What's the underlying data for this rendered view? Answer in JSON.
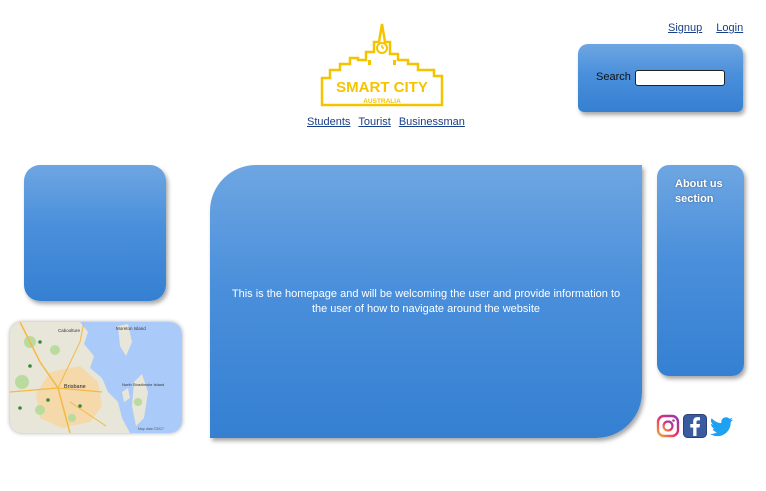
{
  "header": {
    "signup_label": "Signup",
    "login_label": "Login"
  },
  "logo": {
    "title": "SMART CITY",
    "subtitle": "AUSTRALIA",
    "color": "#f5c400"
  },
  "nav": {
    "items": [
      {
        "label": "Students"
      },
      {
        "label": "Tourist"
      },
      {
        "label": "Businessman"
      }
    ]
  },
  "search": {
    "label": "Search",
    "value": ""
  },
  "main": {
    "text": "This is the homepage and will be welcoming the user and provide information to the user of how to navigate around the website"
  },
  "about": {
    "text": "About us section"
  },
  "map": {
    "labels": [
      "Caboolture",
      "Moreton Island",
      "Brisbane",
      "North Stradbroke Island",
      "Map data ©2017"
    ]
  },
  "social": {
    "icons": [
      "instagram-icon",
      "facebook-icon",
      "twitter-icon"
    ]
  },
  "colors": {
    "panel_blue": "#4a8fdb",
    "link": "#1a3f8a"
  }
}
